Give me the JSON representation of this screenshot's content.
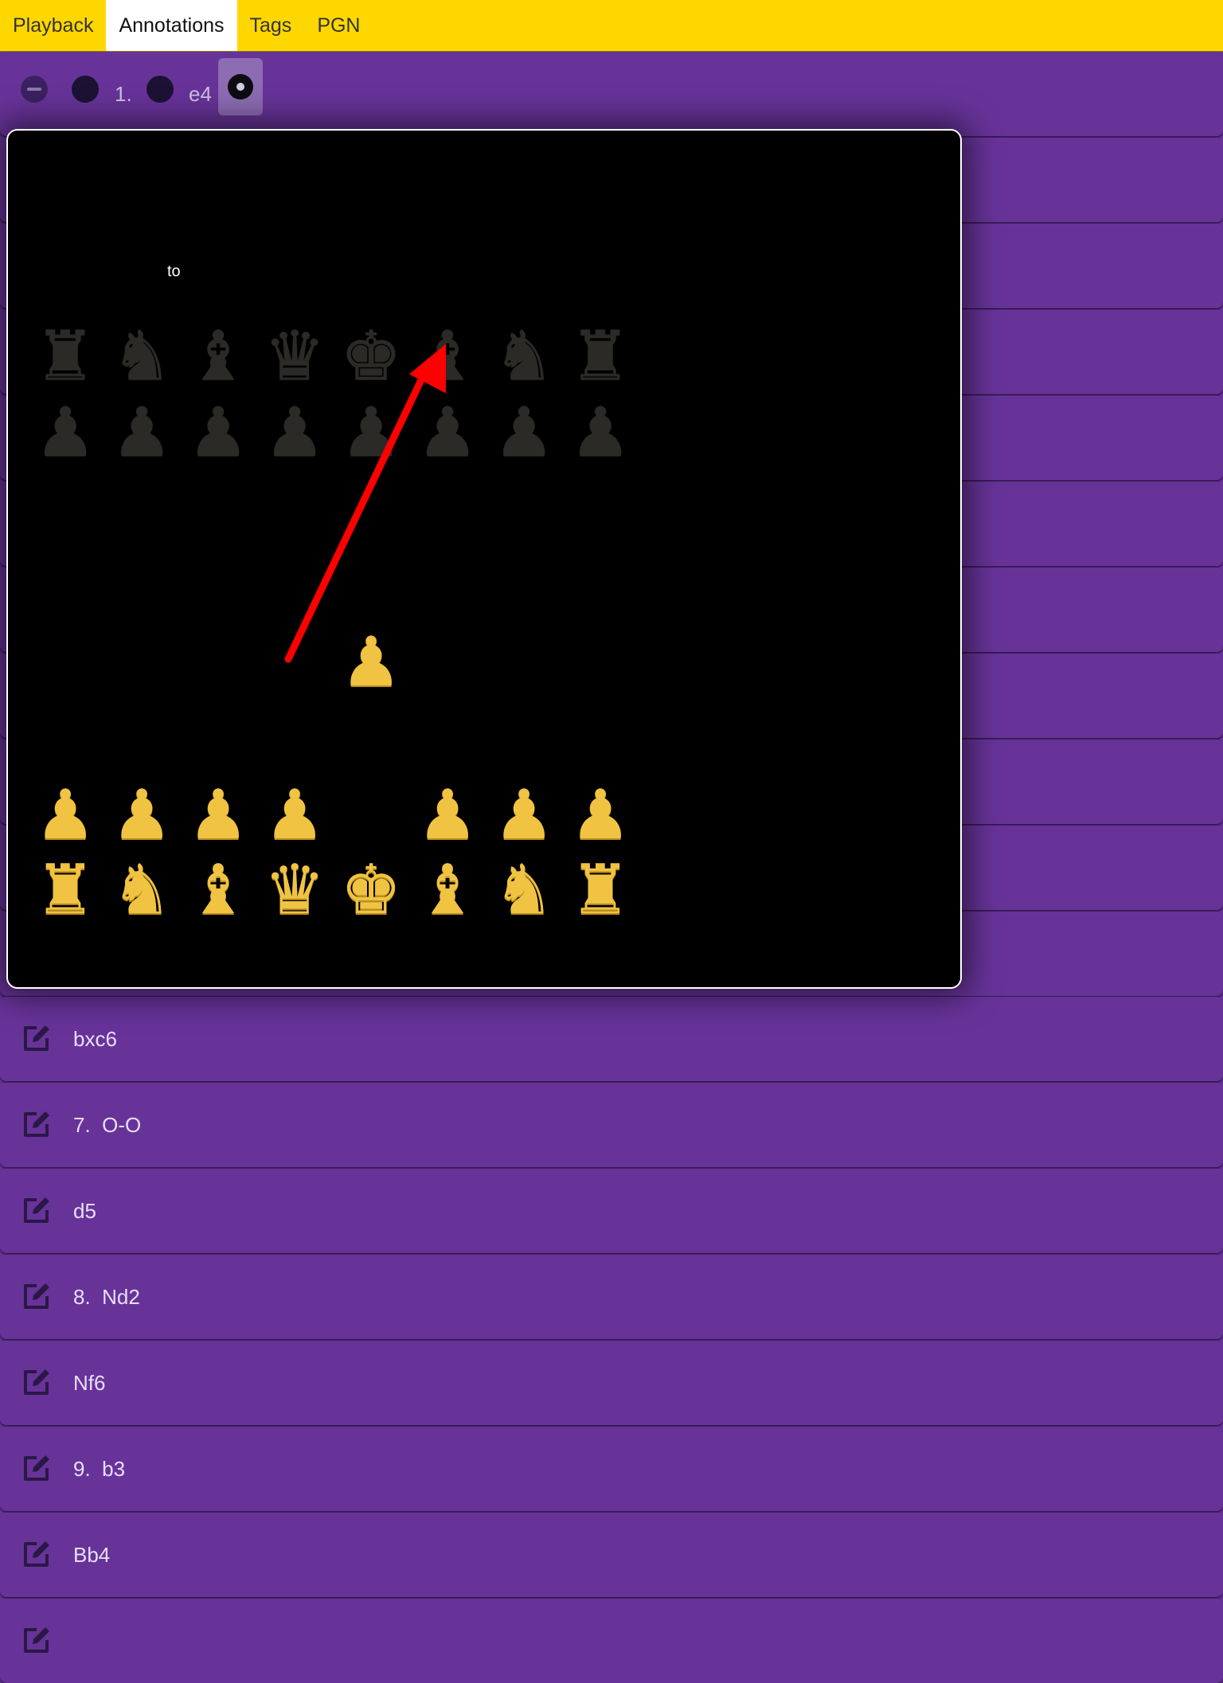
{
  "tabs": [
    {
      "label": "Playback",
      "active": false
    },
    {
      "label": "Annotations",
      "active": true
    },
    {
      "label": "Tags",
      "active": false
    },
    {
      "label": "PGN",
      "active": false
    }
  ],
  "toolbar": {
    "move_number": "1.",
    "move": "e4",
    "icons": [
      "minus-icon",
      "dot-icon",
      "dot-icon",
      "record-icon"
    ]
  },
  "board_popup": {
    "arrow_label": "to",
    "arrow_color": "#ff0000",
    "pieces": {
      "black_back": [
        "♜",
        "♞",
        "♝",
        "♛",
        "♚",
        "♝",
        "♞",
        "♜"
      ],
      "black_pawns": [
        "♟",
        "♟",
        "♟",
        "♟",
        "♟",
        "♟",
        "♟",
        "♟"
      ],
      "white_pawns": [
        "♟",
        "♟",
        "♟",
        "♟",
        "",
        "♟",
        "♟",
        "♟"
      ],
      "white_back": [
        "♜",
        "♞",
        "♝",
        "♛",
        "♚",
        "♝",
        "♞",
        "♜"
      ],
      "white_advanced_pawn": "♟"
    }
  },
  "moves": [
    {
      "label": "bxc6"
    },
    {
      "label": "7.  O-O"
    },
    {
      "label": "d5"
    },
    {
      "label": "8.  Nd2"
    },
    {
      "label": "Nf6"
    },
    {
      "label": "9.  b3"
    },
    {
      "label": "Bb4"
    },
    {
      "label": ""
    }
  ],
  "colors": {
    "tabbar": "#ffd700",
    "row": "#673399",
    "modal_bg": "#000000",
    "white_pieces": "#f0c342"
  }
}
